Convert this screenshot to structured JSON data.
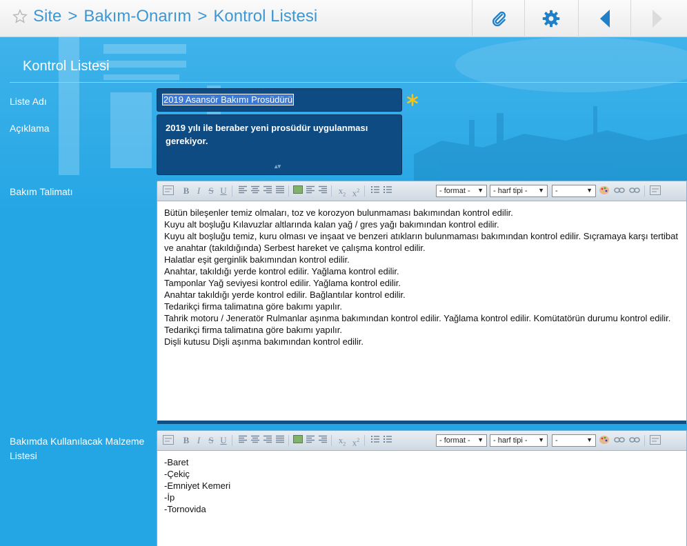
{
  "header": {
    "breadcrumb": [
      "Site",
      "Bakım-Onarım",
      "Kontrol Listesi"
    ],
    "separator": ">",
    "buttons": [
      "paperclip-icon",
      "gear-icon",
      "back-arrow-icon",
      "forward-arrow-icon"
    ],
    "colors": {
      "breadcrumb": "#3d97d3",
      "icon_accent": "#1f7fc7"
    }
  },
  "form": {
    "section_title": "Kontrol Listesi",
    "liste_adi": {
      "label": "Liste Adı",
      "value": "2019 Asansör Bakımı Prosüdürü",
      "required": true
    },
    "aciklama": {
      "label": "Açıklama",
      "value": "2019 yılı ile beraber yeni prosüdür uygulanması gerekiyor."
    },
    "bakim_talimati": {
      "label": "Bakım Talimatı",
      "lines": [
        "Bütün bileşenler temiz olmaları, toz ve korozyon bulunmaması bakımından kontrol edilir.",
        "Kuyu alt boşluğu Kılavuzlar altlarında kalan yağ / gres yağı bakımından kontrol edilir.",
        "Kuyu alt boşluğu temiz, kuru olması ve inşaat ve benzeri atıkların bulunmaması bakımından kontrol edilir. Sıçramaya karşı tertibat ve anahtar (takıldığında) Serbest hareket ve çalışma kontrol edilir.",
        "Halatlar eşit gerginlik bakımından kontrol edilir.",
        "Anahtar, takıldığı yerde kontrol edilir. Yağlama kontrol edilir.",
        "Tamponlar Yağ seviyesi kontrol edilir. Yağlama kontrol edilir.",
        "Anahtar takıldığı yerde kontrol edilir. Bağlantılar kontrol edilir.",
        "Tedarikçi firma talimatına göre bakımı yapılır.",
        "Tahrik motoru / Jeneratör Rulmanlar aşınma bakımından kontrol edilir. Yağlama kontrol edilir. Komütatörün durumu kontrol edilir.",
        "Tedarikçi firma talimatına göre bakımı yapılır.",
        "Dişli kutusu Dişli aşınma bakımından kontrol edilir."
      ]
    },
    "malzeme_listesi": {
      "label": "Bakımda Kullanılacak Malzeme Listesi",
      "lines": [
        "-Baret",
        "-Çekiç",
        "-Emniyet Kemeri",
        "-İp",
        "-Tornovida"
      ]
    }
  },
  "editor_toolbar": {
    "selects": [
      "- format -",
      "- harf tipi -",
      "-"
    ],
    "icons": [
      "html-icon",
      "bold-icon",
      "italic-icon",
      "strikethrough-icon",
      "underline-icon",
      "align-left-icon",
      "align-center-icon",
      "align-right-icon",
      "align-justify-icon",
      "image-icon",
      "indent-icon",
      "outdent-icon",
      "subscript-icon",
      "superscript-icon",
      "ordered-list-icon",
      "unordered-list-icon",
      "color-palette-icon",
      "link-icon",
      "unlink-icon",
      "spellcheck-icon"
    ],
    "glyphs": {
      "bold": "B",
      "italic": "I",
      "strike": "S",
      "underline": "U",
      "sub": "x",
      "sup": "x"
    }
  },
  "colors": {
    "main_bg": "#24a6e4",
    "field_bg": "#0e4b82",
    "required_star": "#f6c317"
  }
}
